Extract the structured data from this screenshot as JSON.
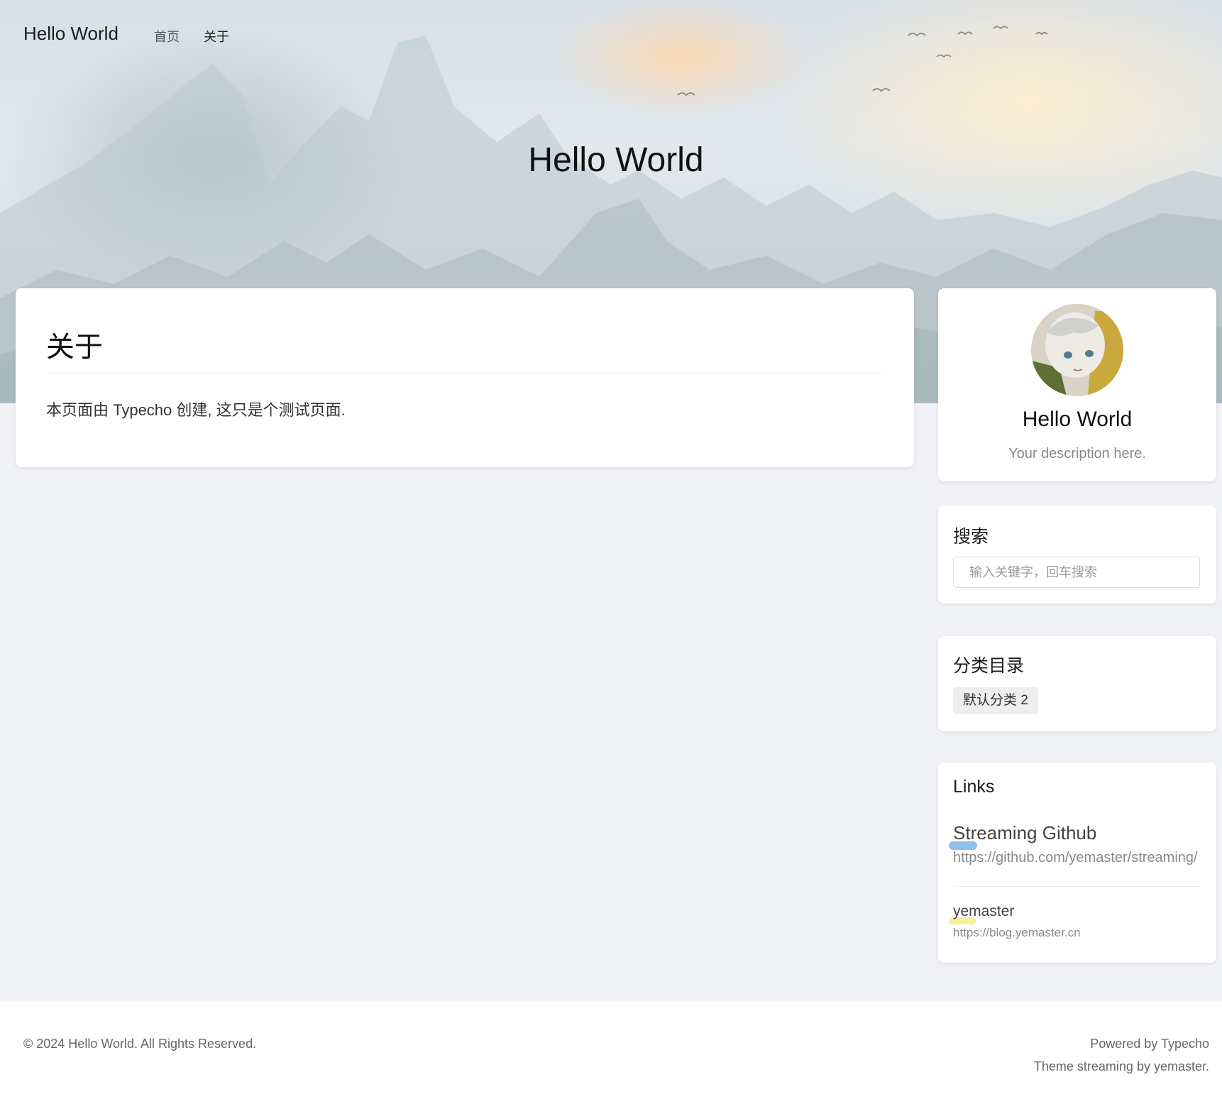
{
  "site": {
    "brand": "Hello World",
    "hero_title": "Hello World"
  },
  "nav": {
    "items": [
      {
        "label": "首页"
      },
      {
        "label": "关于"
      }
    ]
  },
  "page": {
    "title": "关于",
    "content": "本页面由 Typecho 创建, 这只是个测试页面."
  },
  "sidebar": {
    "profile": {
      "name": "Hello World",
      "description": "Your description here."
    },
    "search": {
      "title": "搜索",
      "placeholder": "输入关键字，回车搜索"
    },
    "categories": {
      "title": "分类目录",
      "items": [
        {
          "label": "默认分类 2"
        }
      ]
    },
    "links": {
      "title": "Links",
      "items": [
        {
          "title": "Streaming Github",
          "url": "https://github.com/yemaster/streaming/",
          "mark_color": "#8fc0ec"
        },
        {
          "title": "yemaster",
          "url": "https://blog.yemaster.cn",
          "mark_color": "#f7ee9a"
        }
      ]
    }
  },
  "footer": {
    "copyright": "© 2024 Hello World. All Rights Reserved.",
    "powered": "Powered by Typecho",
    "theme": "Theme streaming by yemaster."
  },
  "colors": {
    "page_bg": "#f1f2f5",
    "card_bg": "#ffffff",
    "tag_bg": "#eeeeee"
  }
}
